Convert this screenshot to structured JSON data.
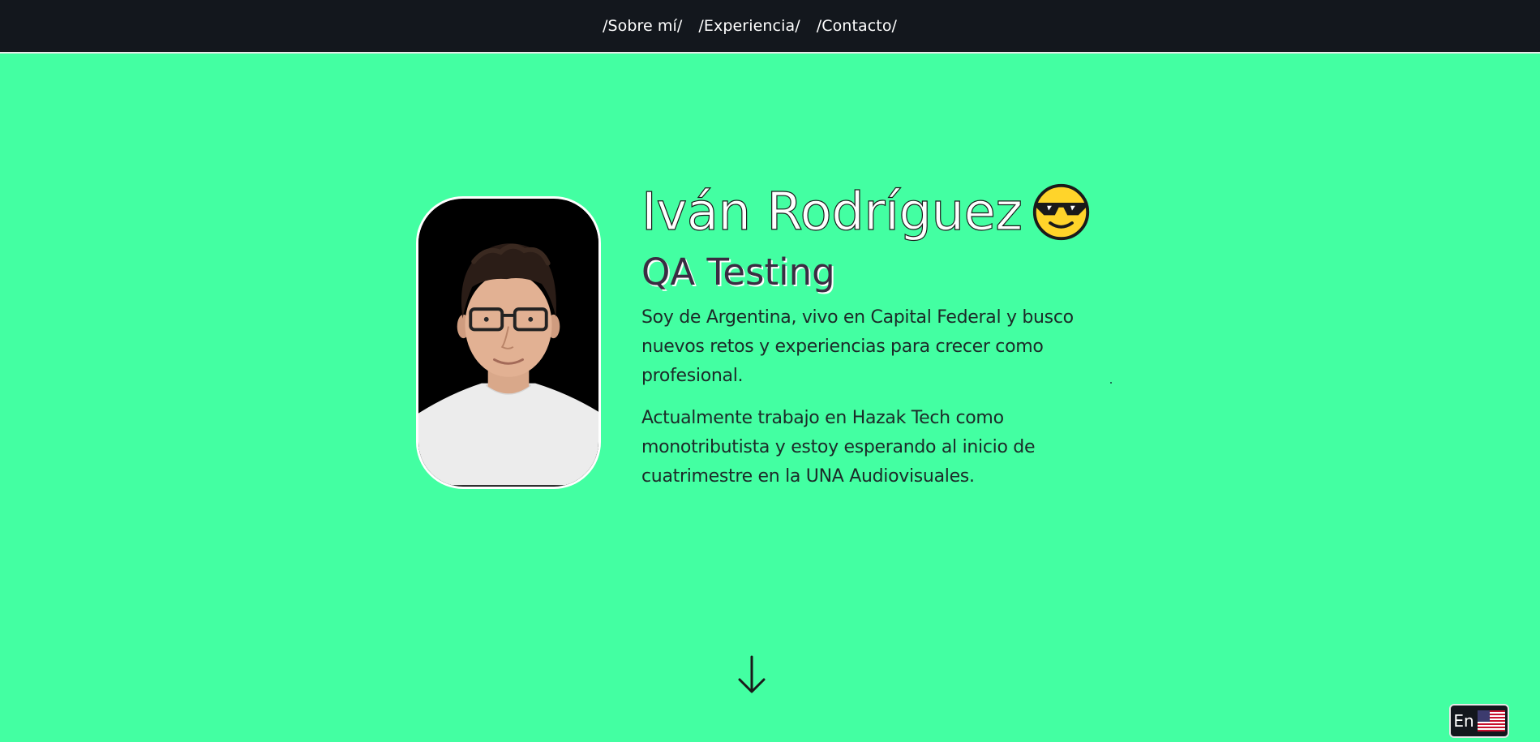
{
  "nav": {
    "links": [
      "/Sobre mí/",
      "/Experiencia/",
      "/Contacto/"
    ]
  },
  "hero": {
    "name": "Iván Rodríguez",
    "emoji": "smiling-face-with-sunglasses-icon",
    "subtitle": "QA Testing",
    "paragraphs": [
      "Soy de Argentina, vivo en Capital Federal y busco nuevos retos y experiencias para crecer como profesional.",
      "Actualmente trabajo en Hazak Tech como monotributista y estoy esperando al inicio de cuatrimestre en la UNA Audiovisuales."
    ]
  },
  "scroll": {
    "icon": "arrow-down-icon"
  },
  "language": {
    "label": "En",
    "icon": "us-flag-icon"
  },
  "colors": {
    "background": "#43ffa2",
    "nav_background": "#13171d",
    "text_dark": "#1c2a28"
  }
}
